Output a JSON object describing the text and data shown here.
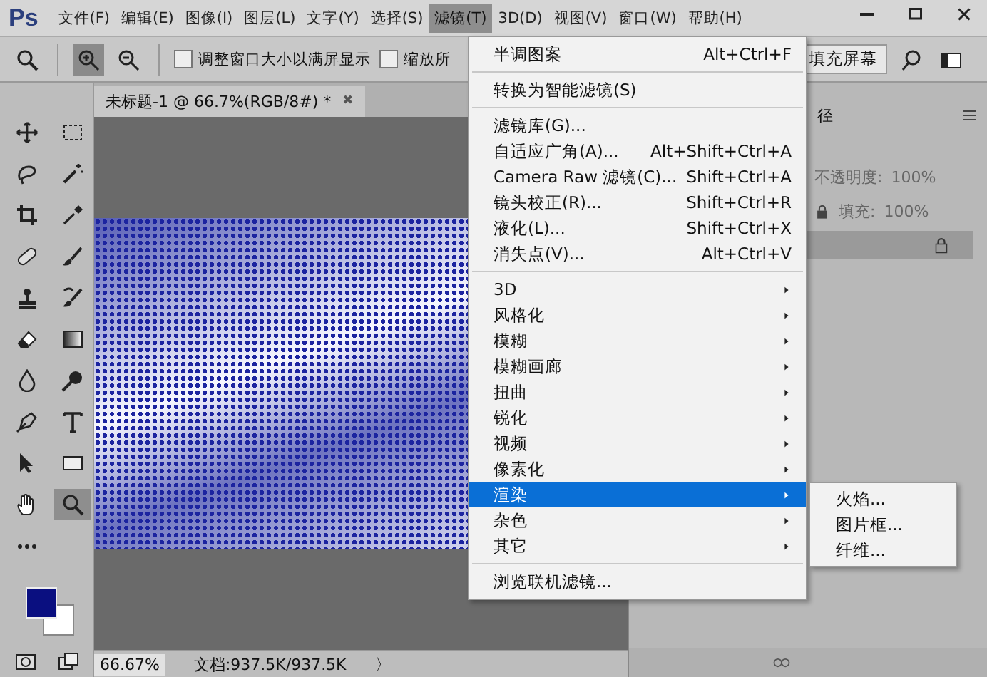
{
  "menu_bar": {
    "logo": "Ps",
    "items": [
      {
        "label": "文件(F)",
        "selected": false
      },
      {
        "label": "编辑(E)",
        "selected": false
      },
      {
        "label": "图像(I)",
        "selected": false
      },
      {
        "label": "图层(L)",
        "selected": false
      },
      {
        "label": "文字(Y)",
        "selected": false
      },
      {
        "label": "选择(S)",
        "selected": false
      },
      {
        "label": "滤镜(T)",
        "selected": true
      },
      {
        "label": "3D(D)",
        "selected": false
      },
      {
        "label": "视图(V)",
        "selected": false
      },
      {
        "label": "窗口(W)",
        "selected": false
      },
      {
        "label": "帮助(H)",
        "selected": false
      }
    ]
  },
  "options_bar": {
    "zoom_in_selected": true,
    "checkboxes": [
      {
        "label": "调整窗口大小以满屏显示",
        "checked": false
      },
      {
        "label": "缩放所",
        "checked": false
      }
    ],
    "button": "填充屏幕"
  },
  "document_tab": {
    "title": "未标题-1 @ 66.7%(RGB/8#) *",
    "close": "✖"
  },
  "tools": [
    {
      "kind": "move",
      "selected": false
    },
    {
      "kind": "marquee",
      "selected": false
    },
    {
      "kind": "lasso",
      "selected": false
    },
    {
      "kind": "wand",
      "selected": false
    },
    {
      "kind": "crop",
      "selected": false
    },
    {
      "kind": "eyedropper",
      "selected": false
    },
    {
      "kind": "healing",
      "selected": false
    },
    {
      "kind": "brush",
      "selected": false
    },
    {
      "kind": "stamp",
      "selected": false
    },
    {
      "kind": "history",
      "selected": false
    },
    {
      "kind": "eraser",
      "selected": false
    },
    {
      "kind": "gradient",
      "selected": false
    },
    {
      "kind": "blur",
      "selected": false
    },
    {
      "kind": "dodge",
      "selected": false
    },
    {
      "kind": "pen",
      "selected": false
    },
    {
      "kind": "type",
      "selected": false
    },
    {
      "kind": "select",
      "selected": false
    },
    {
      "kind": "rect",
      "selected": false
    },
    {
      "kind": "hand",
      "selected": false
    },
    {
      "kind": "zoom",
      "selected": true
    }
  ],
  "status_bar": {
    "zoom": "66.67%",
    "doc_info": "文档:937.5K/937.5K",
    "arrow": "〉"
  },
  "layers_panel": {
    "tab": "径",
    "opacity_label": "不透明度:",
    "opacity": "100%",
    "fill_label": "填充:",
    "fill": "100%"
  },
  "filter_menu": {
    "items": [
      {
        "kind": "item",
        "label": "半调图案",
        "shortcut": "Alt+Ctrl+F",
        "selected": false
      },
      {
        "kind": "separator"
      },
      {
        "kind": "item",
        "label": "转换为智能滤镜(S)",
        "selected": false
      },
      {
        "kind": "separator"
      },
      {
        "kind": "item",
        "label": "滤镜库(G)...",
        "selected": false
      },
      {
        "kind": "item",
        "label": "自适应广角(A)...",
        "shortcut": "Alt+Shift+Ctrl+A",
        "selected": false
      },
      {
        "kind": "item",
        "label": "Camera Raw 滤镜(C)...",
        "shortcut": "Shift+Ctrl+A",
        "selected": false
      },
      {
        "kind": "item",
        "label": "镜头校正(R)...",
        "shortcut": "Shift+Ctrl+R",
        "selected": false
      },
      {
        "kind": "item",
        "label": "液化(L)...",
        "shortcut": "Shift+Ctrl+X",
        "selected": false
      },
      {
        "kind": "item",
        "label": "消失点(V)...",
        "shortcut": "Alt+Ctrl+V",
        "selected": false
      },
      {
        "kind": "separator"
      },
      {
        "kind": "submenu",
        "label": "3D",
        "selected": false
      },
      {
        "kind": "submenu",
        "label": "风格化",
        "selected": false
      },
      {
        "kind": "submenu",
        "label": "模糊",
        "selected": false
      },
      {
        "kind": "submenu",
        "label": "模糊画廊",
        "selected": false
      },
      {
        "kind": "submenu",
        "label": "扭曲",
        "selected": false
      },
      {
        "kind": "submenu",
        "label": "锐化",
        "selected": false
      },
      {
        "kind": "submenu",
        "label": "视频",
        "selected": false
      },
      {
        "kind": "submenu",
        "label": "像素化",
        "selected": false
      },
      {
        "kind": "submenu",
        "label": "渲染",
        "selected": true
      },
      {
        "kind": "submenu",
        "label": "杂色",
        "selected": false
      },
      {
        "kind": "submenu",
        "label": "其它",
        "selected": false
      },
      {
        "kind": "separator"
      },
      {
        "kind": "item",
        "label": "浏览联机滤镜...",
        "selected": false
      }
    ]
  },
  "render_submenu": {
    "items": [
      {
        "label": "火焰..."
      },
      {
        "label": "图片框..."
      },
      {
        "label": "纤维..."
      }
    ]
  }
}
